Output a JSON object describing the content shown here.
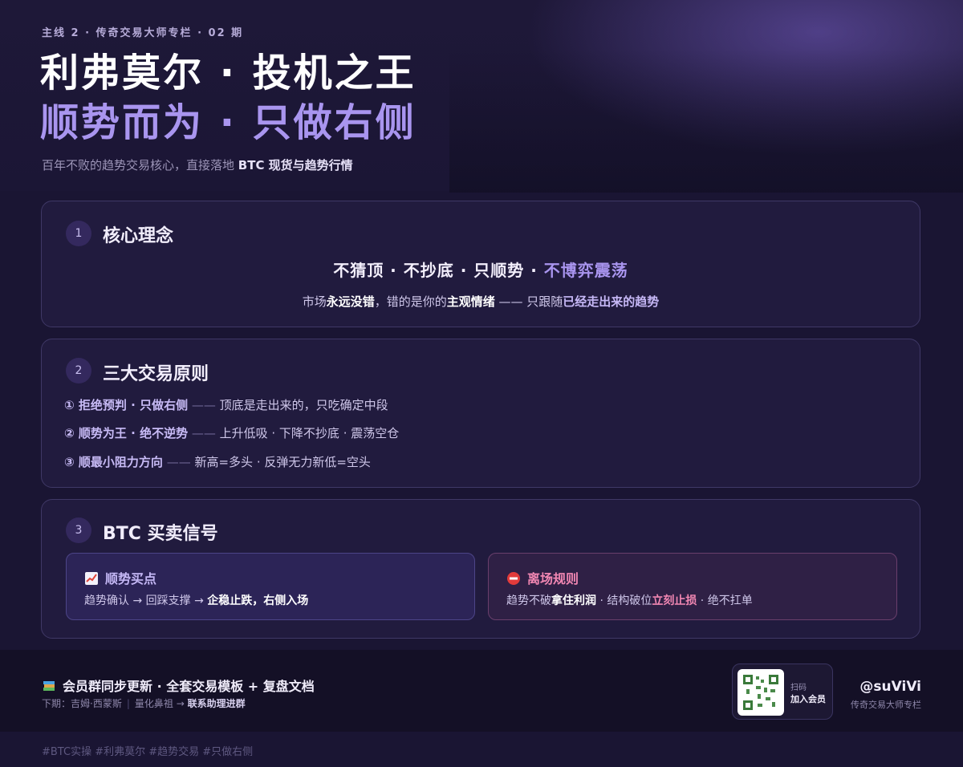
{
  "header": {
    "issue_line": "主线 2 · 传奇交易大师专栏 · 02 期",
    "title_line1": "利弗莫尔 · 投机之王",
    "title_line2": "顺势而为 · 只做右侧",
    "subtitle_prefix": "百年不败的趋势交易核心，直接落地 ",
    "subtitle_bold": "BTC 现货与趋势行情"
  },
  "section1": {
    "number": "1",
    "title": "核心理念",
    "main_plain": "不猜顶 · 不抄底 · 只顺势 · ",
    "main_highlight": "不博弈震荡",
    "sub_1": "市场",
    "sub_2": "永远没错",
    "sub_3": "，错的是你的",
    "sub_4": "主观情绪",
    "sub_5": " —— 只跟随",
    "sub_6": "已经走出来的趋势"
  },
  "section2": {
    "number": "2",
    "title": "三大交易原则",
    "rules": [
      {
        "bold": "① 拒绝预判 · 只做右侧",
        "dash": " —— ",
        "text": "顶底是走出来的，只吃确定中段"
      },
      {
        "bold": "② 顺势为王 · 绝不逆势",
        "dash": " —— ",
        "text": "上升低吸 · 下降不抄底 · 震荡空仓"
      },
      {
        "bold": "③ 顺最小阻力方向",
        "dash": " —— ",
        "text": "新高=多头 · 反弹无力新低=空头"
      }
    ]
  },
  "section3": {
    "number": "3",
    "title": "BTC 买卖信号",
    "buy": {
      "icon": "chart-up-icon",
      "title": "顺势买点",
      "body_plain": "趋势确认 → 回踩支撑 → ",
      "body_bold": "企稳止跌，右侧入场"
    },
    "exit": {
      "icon": "no-entry-icon",
      "title": "离场规则",
      "b1": "趋势不破",
      "b2": "拿住利润",
      "b3": " · 结构破位",
      "b4": "立刻止损",
      "b5": " · 绝不扛单"
    }
  },
  "footer": {
    "icon": "books-icon",
    "main": "会员群同步更新 · 全套交易模板 + 复盘文档",
    "next_label": "下期：吉姆·西蒙斯",
    "next_sub": "量化鼻祖 → ",
    "next_link": "联系助理进群",
    "qr_line1": "扫码",
    "qr_line2": "加入会员",
    "handle": "@suViVi",
    "handle_sub": "传奇交易大师专栏"
  },
  "tags": "#BTC实操 #利弗莫尔 #趋势交易 #只做右侧",
  "colors": {
    "background": "#1a1533",
    "accent_purple": "#a995ef",
    "exit_pink": "#f287b3",
    "card_border": "#3f3866"
  }
}
